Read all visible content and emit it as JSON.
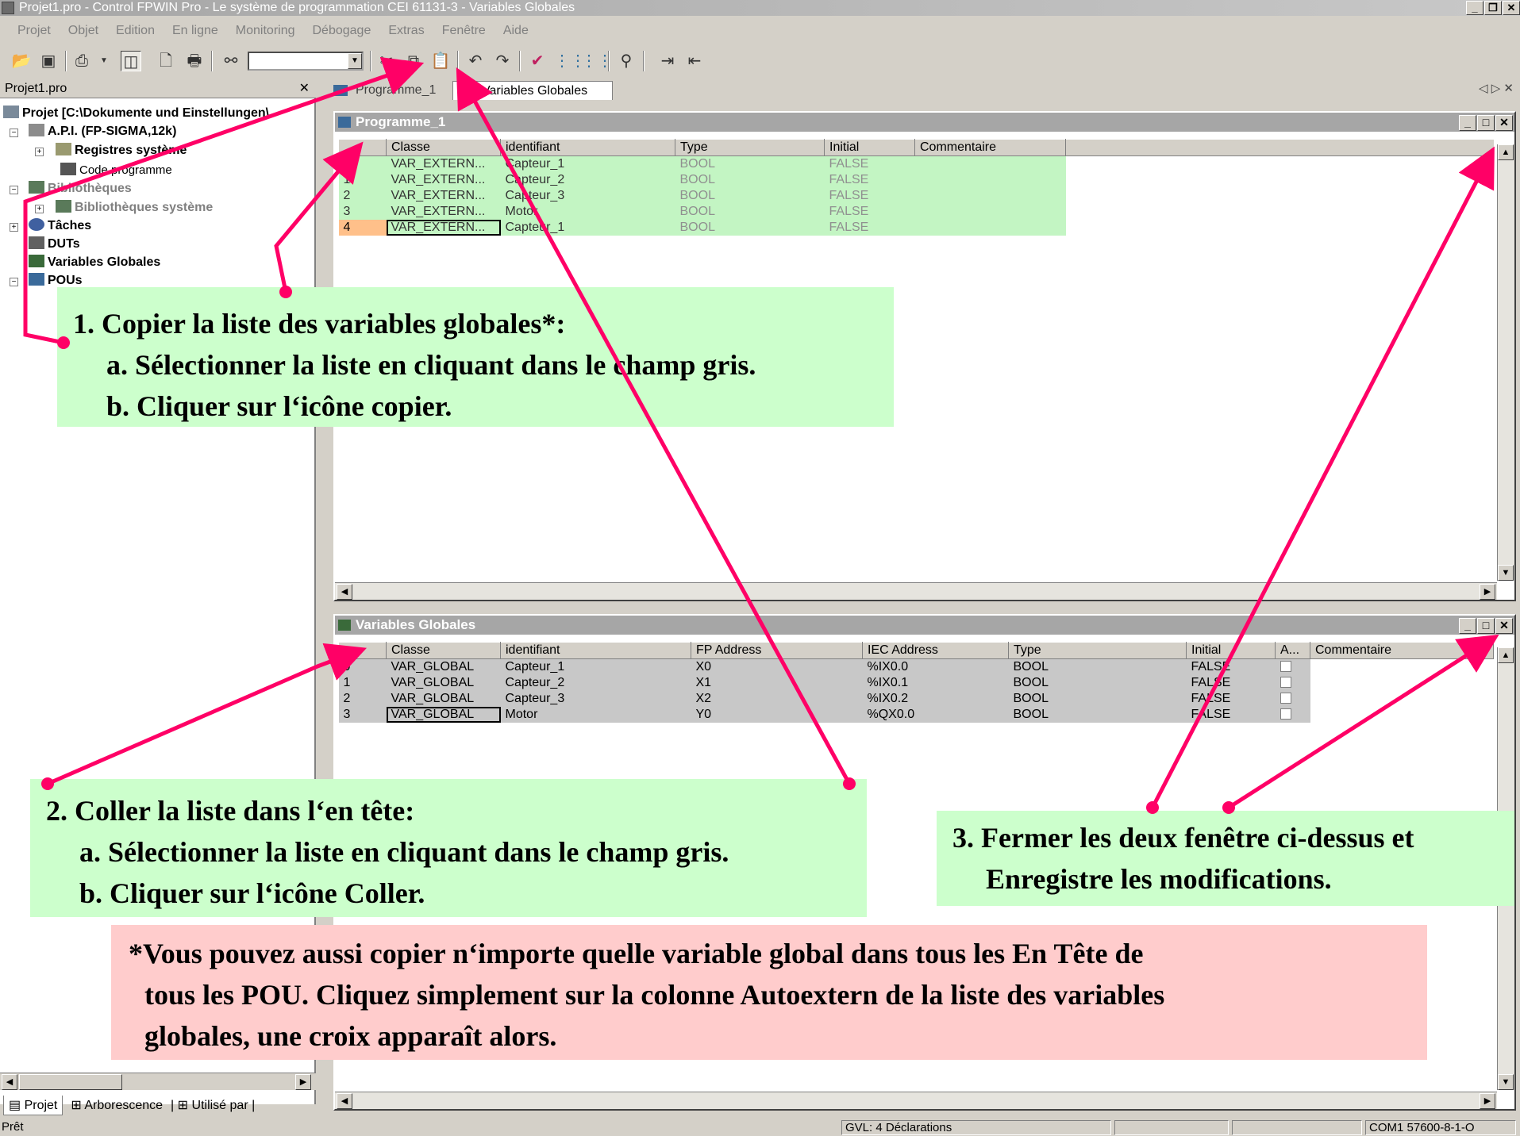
{
  "window": {
    "title": "Projet1.pro - Control FPWIN Pro - Le système de programmation CEI 61131-3 - Variables Globales"
  },
  "menu": [
    "Projet",
    "Objet",
    "Edition",
    "En ligne",
    "Monitoring",
    "Débogage",
    "Extras",
    "Fenêtre",
    "Aide"
  ],
  "left_pane": {
    "header": "Projet1.pro",
    "tree": {
      "root": "Projet [C:\\Dokumente und Einstellungen\\",
      "api": "A.P.I. (FP-SIGMA,12k)",
      "registres": "Registres système",
      "code": "Code programme",
      "bibliotheques": "Bibliothèques",
      "bib_systeme": "Bibliothèques système",
      "taches": "Tâches",
      "duts": "DUTs",
      "variables_globales": "Variables Globales",
      "pous": "POUs"
    },
    "tabs": [
      "Projet",
      "Arborescence",
      "Utilisé par"
    ]
  },
  "doc_tabs": [
    "Programme_1",
    "Variables Globales"
  ],
  "programme_window": {
    "title": "Programme_1",
    "columns": [
      "",
      "Classe",
      "identifiant",
      "Type",
      "Initial",
      "Commentaire"
    ],
    "rows": [
      [
        "0",
        "VAR_EXTERN...",
        "Capteur_1",
        "BOOL",
        "FALSE",
        ""
      ],
      [
        "1",
        "VAR_EXTERN...",
        "Capteur_2",
        "BOOL",
        "FALSE",
        ""
      ],
      [
        "2",
        "VAR_EXTERN...",
        "Capteur_3",
        "BOOL",
        "FALSE",
        ""
      ],
      [
        "3",
        "VAR_EXTERN...",
        "Motor",
        "BOOL",
        "FALSE",
        ""
      ],
      [
        "4",
        "VAR_EXTERN...",
        "Capteur_1",
        "BOOL",
        "FALSE",
        ""
      ]
    ]
  },
  "gvl_window": {
    "title": "Variables Globales",
    "columns": [
      "",
      "Classe",
      "identifiant",
      "FP Address",
      "IEC Address",
      "Type",
      "Initial",
      "A...",
      "Commentaire"
    ],
    "rows": [
      [
        "0",
        "VAR_GLOBAL",
        "Capteur_1",
        "X0",
        "%IX0.0",
        "BOOL",
        "FALSE"
      ],
      [
        "1",
        "VAR_GLOBAL",
        "Capteur_2",
        "X1",
        "%IX0.1",
        "BOOL",
        "FALSE"
      ],
      [
        "2",
        "VAR_GLOBAL",
        "Capteur_3",
        "X2",
        "%IX0.2",
        "BOOL",
        "FALSE"
      ],
      [
        "3",
        "VAR_GLOBAL",
        "Motor",
        "Y0",
        "%QX0.0",
        "BOOL",
        "FALSE"
      ]
    ]
  },
  "status": {
    "left": "Prêt",
    "gvl": "GVL: 4 Déclarations",
    "com": "COM1 57600-8-1-O"
  },
  "callouts": {
    "step1": [
      "1. Copier la liste des variables globales*:",
      "a. Sélectionner la liste en cliquant dans le champ gris.",
      "b. Cliquer sur l‘icône copier."
    ],
    "step2": [
      "2. Coller la liste dans l‘en tête:",
      "a. Sélectionner la liste en cliquant dans le champ gris.",
      "b. Cliquer sur l‘icône Coller."
    ],
    "step3": [
      "3. Fermer les deux fenêtre ci-dessus et",
      "Enregistre les modifications."
    ],
    "note": [
      "*Vous pouvez aussi copier n‘importe quelle variable global dans tous les En Tête de",
      "tous les POU. Cliquez simplement sur la colonne Autoextern de la liste des variables",
      "globales, une croix apparaît alors."
    ]
  },
  "colors": {
    "arrow": "#ff0066",
    "callout_green": "#ccffcc",
    "callout_pink": "#ffcccc",
    "row_green": "#c3f5c3",
    "row_grey": "#c8c8c8"
  },
  "icons": [
    "open-icon",
    "save-icon",
    "print-setup-icon",
    "window-icon",
    "preview-icon",
    "print-icon",
    "binoculars-icon",
    "cut-icon",
    "copy-icon",
    "paste-icon",
    "undo-icon",
    "redo-icon",
    "check-icon",
    "compile-icon",
    "build-icon",
    "monitor-icon",
    "indent-icon",
    "outdent-icon"
  ]
}
